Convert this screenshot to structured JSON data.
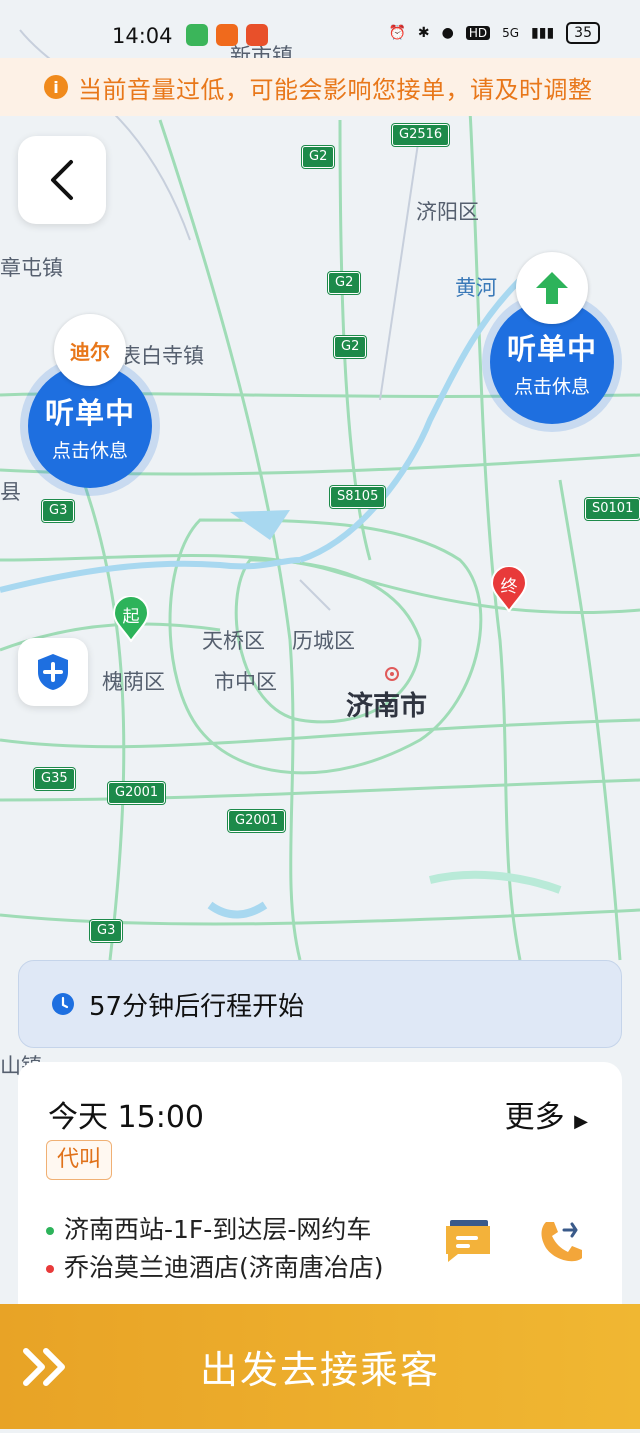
{
  "status_bar": {
    "time": "14:04",
    "network": "5G",
    "battery": "35",
    "hd": "HD"
  },
  "notice": {
    "icon": "i",
    "text": "当前音量过低，可能会影响您接单，请及时调整"
  },
  "map": {
    "labels": [
      "新市镇",
      "济阳区",
      "章屯镇",
      "黄河",
      "表白寺镇",
      "天桥区",
      "历城区",
      "槐荫区",
      "市中区",
      "济南市",
      "山镇",
      "县"
    ],
    "road_shields": [
      "G2516",
      "G2",
      "G2",
      "G2",
      "S8105",
      "G3",
      "S0101",
      "G35",
      "G2001",
      "G2001",
      "G3"
    ],
    "start_pin": "起",
    "end_pin": "终"
  },
  "bubbles": [
    {
      "title": "听单中",
      "sub": "点击休息",
      "logo": "迪尔"
    },
    {
      "title": "听单中",
      "sub": "点击休息",
      "logo": "green-arrow-logo"
    }
  ],
  "trip_banner": {
    "text": "57分钟后行程开始"
  },
  "order_card": {
    "time": "今天 15:00",
    "more": "更多",
    "tag": "代叫",
    "pickup": "济南西站-1F-到达层-网约车",
    "dropoff": "乔治莫兰迪酒店(济南唐冶店)"
  },
  "action_button": {
    "label": "出发去接乘客"
  },
  "colors": {
    "accent_blue": "#1e6fe0",
    "orange": "#f08a1c",
    "go_button": "#eeb030",
    "road_green": "#1d8a4a"
  }
}
